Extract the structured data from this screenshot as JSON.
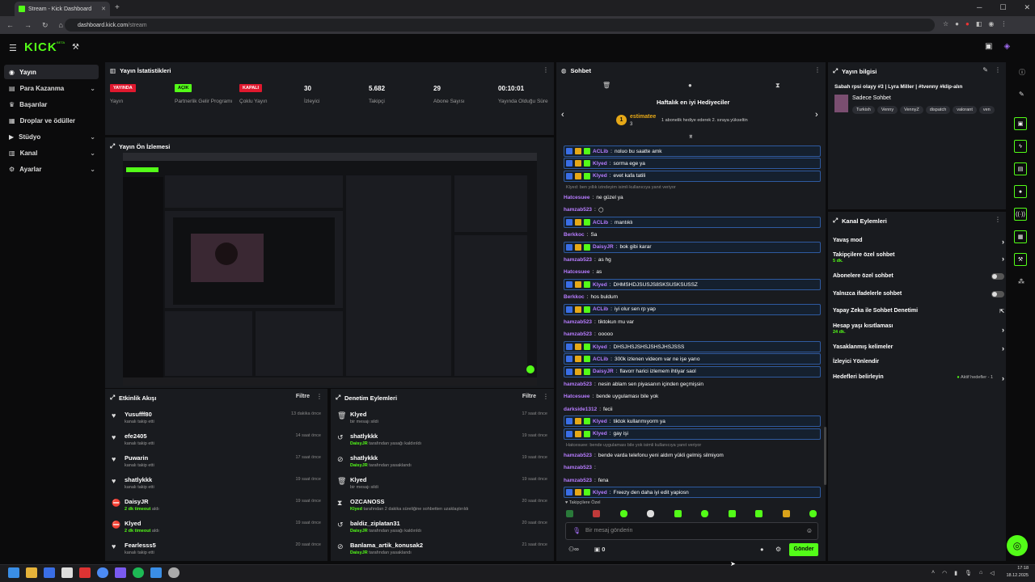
{
  "browser": {
    "tab_title": "Stream - Kick Dashboard",
    "url_host": "dashboard.kick.com",
    "url_path": "/stream"
  },
  "header": {
    "logo": "KICK",
    "logo_sup": "BETA"
  },
  "sidebar": {
    "items": [
      {
        "label": "Yayın",
        "icon": "radio-icon",
        "active": true
      },
      {
        "label": "Para Kazanma",
        "icon": "money-icon",
        "chevron": true
      },
      {
        "label": "Başarılar",
        "icon": "trophy-icon"
      },
      {
        "label": "Droplar ve ödüller",
        "icon": "gift-icon"
      },
      {
        "label": "Stüdyo",
        "icon": "studio-icon",
        "chevron": true
      },
      {
        "label": "Kanal",
        "icon": "channel-icon",
        "chevron": true
      },
      {
        "label": "Ayarlar",
        "icon": "gear-icon",
        "chevron": true
      }
    ]
  },
  "stats": {
    "title": "Yayın İstatistikleri",
    "items": [
      {
        "value": "YAYINDA",
        "label": "Yayın",
        "kind": "red"
      },
      {
        "value": "AÇIK",
        "label": "Partnerlik Gelir Programı",
        "kind": "green"
      },
      {
        "value": "KAPALI",
        "label": "Çoklu Yayın",
        "kind": "red"
      },
      {
        "value": "30",
        "label": "İzleyici",
        "kind": "num"
      },
      {
        "value": "5.682",
        "label": "Takipçi",
        "kind": "num"
      },
      {
        "value": "29",
        "label": "Abone Sayısı",
        "kind": "num"
      },
      {
        "value": "00:10:01",
        "label": "Yayında Olduğu Süre",
        "kind": "num"
      }
    ]
  },
  "preview": {
    "title": "Yayın Ön İzlemesi"
  },
  "activity": {
    "title": "Etkinlik Akışı",
    "filter": "Filtre",
    "rows": [
      {
        "icon": "heart-icon",
        "name": "Yusufff80",
        "sub": "kanalı takip etti",
        "time": "13 dakika önce"
      },
      {
        "icon": "heart-icon",
        "name": "efe2405",
        "sub": "kanalı takip etti",
        "time": "14 saat önce"
      },
      {
        "icon": "heart-icon",
        "name": "Puwarin",
        "sub": "kanalı takip etti",
        "time": "17 saat önce"
      },
      {
        "icon": "heart-icon",
        "name": "shatlykkk",
        "sub": "kanalı takip etti",
        "time": "19 saat önce"
      },
      {
        "icon": "timeout-icon",
        "name": "DaisyJR",
        "sub_b": "2 dk timeout",
        "sub": " aldı",
        "time": "19 saat önce"
      },
      {
        "icon": "timeout-icon",
        "name": "Klyed",
        "sub_b": "2 dk timeout",
        "sub": " aldı",
        "time": "19 saat önce"
      },
      {
        "icon": "heart-icon",
        "name": "Fearlesss5",
        "sub": "kanalı takip etti",
        "time": "20 saat önce"
      }
    ]
  },
  "moderation": {
    "title": "Denetim Eylemleri",
    "filter": "Filtre",
    "rows": [
      {
        "icon": "trash-icon",
        "name": "Klyed",
        "sub": "bir mesajı sildi",
        "time": "17 saat önce"
      },
      {
        "icon": "undo-icon",
        "name": "shatlykkk",
        "sub_b": "DaisyJR",
        "sub": " tarafından yasağı kaldırıldı",
        "time": "19 saat önce"
      },
      {
        "icon": "ban-icon",
        "name": "shatlykkk",
        "sub_b": "DaisyJR",
        "sub": " tarafından yasaklandı",
        "time": "19 saat önce"
      },
      {
        "icon": "trash-icon",
        "name": "Klyed",
        "sub": "bir mesajı sildi",
        "time": "19 saat önce"
      },
      {
        "icon": "hourglass-icon",
        "name": "OZCANOSS",
        "sub_b": "Klyed",
        "sub": " tarafından 2 dakika süreliğine sohbetten uzaklaştırıldı",
        "time": "20 saat önce"
      },
      {
        "icon": "undo-icon",
        "name": "baldiz_ziplatan31",
        "sub_b": "DaisyJR",
        "sub": " tarafından yasağı kaldırıldı",
        "time": "20 saat önce"
      },
      {
        "icon": "ban-icon",
        "name": "Banlama_artik_konusak2",
        "sub_b": "DaisyJR",
        "sub": " tarafından yasaklandı",
        "time": "21 saat önce"
      }
    ]
  },
  "chat": {
    "title": "Sohbet",
    "gifter_title": "Haftalık en iyi Hediyeciler",
    "gifter_name": "estimatee",
    "gifter_count": "3",
    "gifter_note": "1 abonelik hediye ederek 2. sıraya yükseltin",
    "messages": [
      {
        "user": "ACLib",
        "text": "noluo bu saatte amk",
        "hl": true,
        "color": "#b77cff"
      },
      {
        "user": "Klyed",
        "text": "sorma ege ya",
        "hl": true,
        "color": "#b77cff"
      },
      {
        "user": "Klyed",
        "text": "evet kafa tatili",
        "hl": true,
        "color": "#b77cff"
      },
      {
        "reply": "Klyed: ben yıllık izindeyim isimli kullanıcıya yanıt veriyor"
      },
      {
        "user": "Hatcesuee",
        "text": "ne güzel ya",
        "color": "#b77cff"
      },
      {
        "user": "hamzab523",
        "text": "🌕",
        "color": "#b77cff"
      },
      {
        "user": "ACLib",
        "text": "mantıklı",
        "hl": true,
        "color": "#b77cff"
      },
      {
        "user": "Berkkoc",
        "text": "Sa",
        "color": "#b77cff"
      },
      {
        "user": "DaisyJR",
        "text": "bok gibi karar",
        "hl": true,
        "color": "#b77cff"
      },
      {
        "user": "hamzab523",
        "text": "as hg",
        "color": "#b77cff"
      },
      {
        "user": "Hatcesuee",
        "text": "as",
        "color": "#b77cff"
      },
      {
        "user": "Klyed",
        "text": "DHMSHDJSUSJS8SKSUSKSUSSZ",
        "hl": true,
        "color": "#b77cff"
      },
      {
        "user": "Berkkoc",
        "text": "hos buldum",
        "color": "#b77cff"
      },
      {
        "user": "ACLib",
        "text": "iyi olur sen rp yap",
        "hl": true,
        "color": "#b77cff"
      },
      {
        "user": "hamzab523",
        "text": "tiktokun mu var",
        "color": "#b77cff"
      },
      {
        "user": "hamzab523",
        "text": "ooooo",
        "color": "#b77cff"
      },
      {
        "user": "Klyed",
        "text": "DHSJHSJSHSJSHSJHSJSSS",
        "hl": true,
        "color": "#b77cff"
      },
      {
        "user": "ACLib",
        "text": "300k izlenen videom var ne işe yarıo",
        "hl": true,
        "color": "#b77cff"
      },
      {
        "user": "DaisyJR",
        "text": "flavorr harici izlemem ihtiyar saol",
        "hl": true,
        "color": "#b77cff"
      },
      {
        "user": "hamzab523",
        "text": "nesin ablam sen piyasanın içinden geçmişsin",
        "color": "#b77cff"
      },
      {
        "user": "Hatcesuee",
        "text": "bende uygulaması bile yok",
        "color": "#b77cff"
      },
      {
        "user": "darkside1312",
        "text": "fecii",
        "color": "#b77cff"
      },
      {
        "user": "Klyed",
        "text": "tiktok kullanmıyorm ya",
        "hl": true,
        "color": "#b77cff"
      },
      {
        "user": "Klyed",
        "text": "gay işi",
        "hl": true,
        "color": "#b77cff"
      },
      {
        "reply": "Hatcesuee: bende uygulaması bile yok isimli kullanıcıya yanıt veriyor"
      },
      {
        "user": "hamzab523",
        "text": "bende varda telefonu yeni aldım yükli gelmiş silmiyom",
        "color": "#b77cff"
      },
      {
        "user": "hamzab523",
        "text": "",
        "color": "#b77cff"
      },
      {
        "user": "hamzab523",
        "text": "fena",
        "color": "#b77cff"
      },
      {
        "user": "Klyed",
        "text": "Freezy den daha iyi edit yapiosn",
        "hl": true,
        "color": "#b77cff"
      }
    ],
    "followers_only": "Takipçilere Özel",
    "input_placeholder": "Bir mesaj gönderin",
    "points": "0",
    "send_label": "Gönder"
  },
  "stream_info": {
    "title": "Yayın bilgisi",
    "stream_title": "Sabah rpsi olayy #3 | Lyra Miller | #tvenny #klip-alın",
    "category": "Sadece Sohbet",
    "tags": [
      "Turkish",
      "Venny",
      "VennyZ",
      "dispatch",
      "valorant",
      "ven"
    ]
  },
  "channel_actions": {
    "title": "Kanal Eylemleri",
    "items": [
      {
        "label": "Yavaş mod",
        "type": "arrow"
      },
      {
        "label": "Takipçilere özel sohbet",
        "sub": "5 dk.",
        "type": "arrow"
      },
      {
        "label": "Abonelere özel sohbet",
        "type": "toggle"
      },
      {
        "label": "Yalnızca ifadelerle sohbet",
        "type": "toggle"
      },
      {
        "label": "Yapay Zeka ile Sohbet Denetimi",
        "type": "link"
      },
      {
        "label": "Hesap yaşı kısıtlaması",
        "sub": "24 dk.",
        "type": "arrow"
      },
      {
        "label": "Yasaklanmış kelimeler",
        "type": "arrow"
      },
      {
        "label": "İzleyici Yönlendir",
        "type": "none"
      },
      {
        "label": "Hedefleri belirleyin",
        "extra": "Aktif hedefler - 1",
        "type": "arrow"
      }
    ]
  },
  "taskbar": {
    "time": "17:18",
    "date": "18.12.2025"
  },
  "colors": {
    "accent": "#53fc18",
    "live_red": "#e0182e",
    "panel": "#191b1f",
    "bg": "#0b0b0c"
  }
}
